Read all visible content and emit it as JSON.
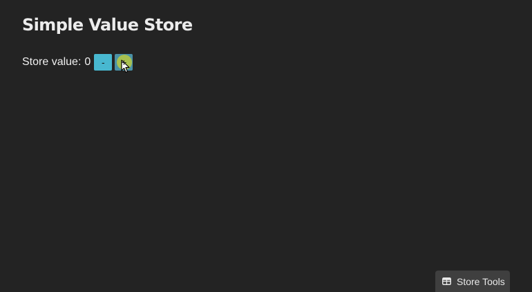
{
  "page": {
    "title": "Simple Value Store"
  },
  "store": {
    "label": "Store value:",
    "value": "0",
    "decrement_label": "-",
    "increment_label": "+"
  },
  "devtools": {
    "button_label": "Store Tools",
    "icon": "table-icon"
  },
  "colors": {
    "background": "#232323",
    "button": "#48b8d0",
    "button_active": "#4a91a6",
    "click_indicator": "#b0c448",
    "tools_background": "#3f3f3f"
  }
}
